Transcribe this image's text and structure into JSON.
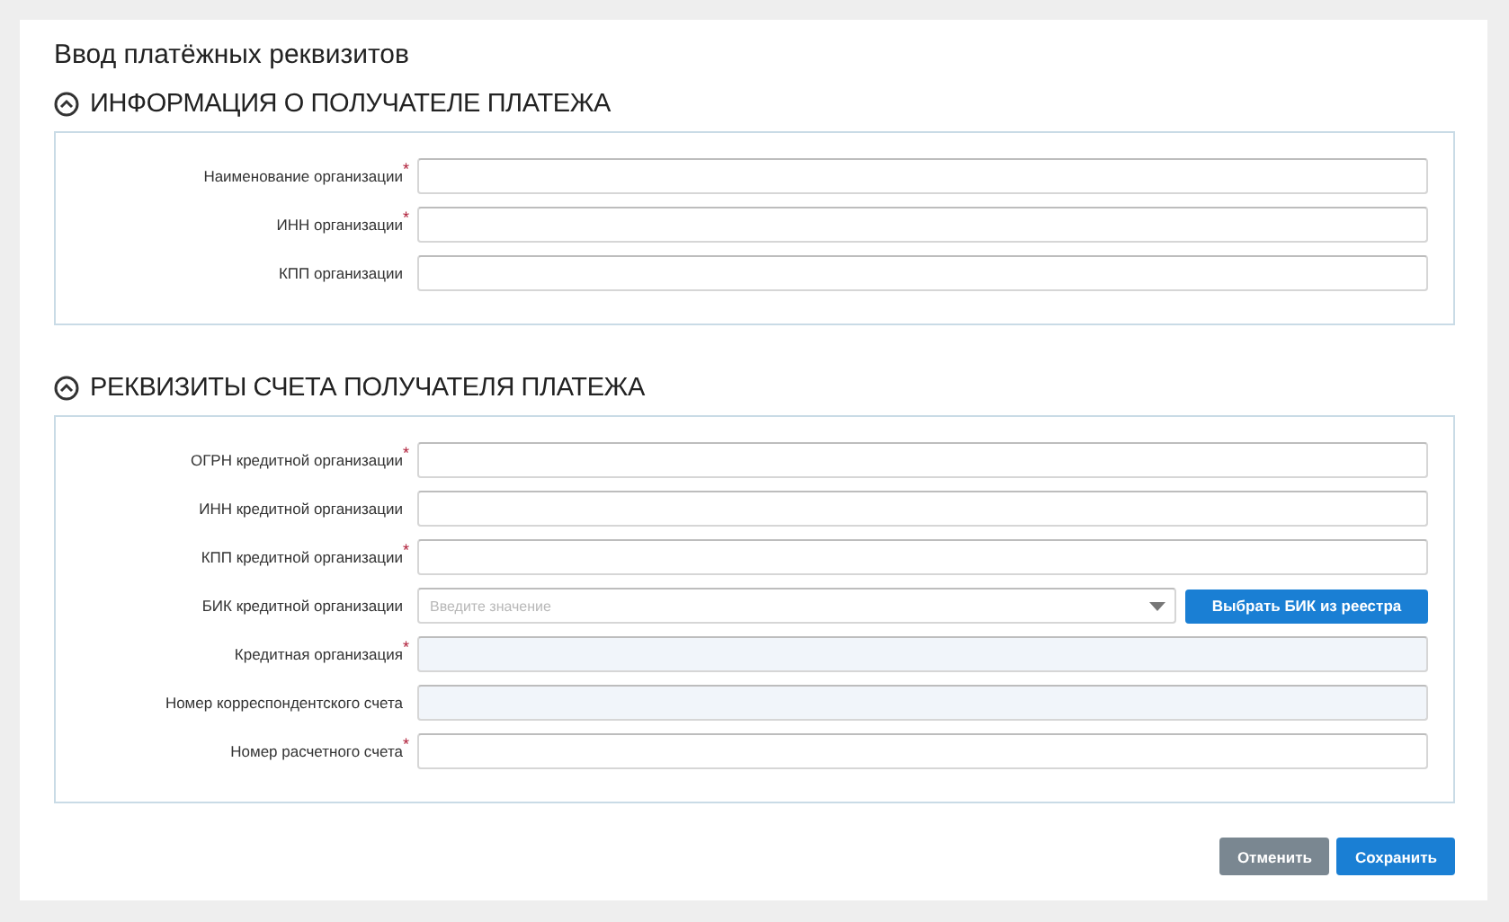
{
  "title": "Ввод платёжных реквизитов",
  "sections": [
    {
      "title": "ИНФОРМАЦИЯ О ПОЛУЧАТЕЛЕ ПЛАТЕЖА",
      "expanded": true,
      "fields": [
        {
          "kind": "text",
          "label": "Наименование организации",
          "required_mark": "*"
        },
        {
          "kind": "text",
          "label": "ИНН организации",
          "required_mark": "*"
        },
        {
          "kind": "text",
          "label": "КПП организации"
        }
      ]
    },
    {
      "title": "РЕКВИЗИТЫ СЧЕТА ПОЛУЧАТЕЛЯ ПЛАТЕЖА",
      "expanded": true,
      "fields": [
        {
          "kind": "text",
          "label": "ОГРН кредитной организации",
          "required_mark": "*"
        },
        {
          "kind": "text",
          "label": "ИНН кредитной организации"
        },
        {
          "kind": "text",
          "label": "КПП кредитной организации",
          "required_mark": "*"
        },
        {
          "kind": "select",
          "label": "БИК кредитной организации",
          "placeholder": "Введите значение",
          "button": "Выбрать БИК из реестра"
        },
        {
          "kind": "readonly",
          "label": "Кредитная организация",
          "required_mark": "*"
        },
        {
          "kind": "readonly",
          "label": "Номер корреспондентского счета"
        },
        {
          "kind": "text",
          "label": "Номер расчетного счета",
          "required_mark": "*"
        }
      ]
    }
  ],
  "buttons": [
    {
      "kind": "secondary",
      "label": "Отменить"
    },
    {
      "kind": "primary",
      "label": "Сохранить"
    }
  ]
}
